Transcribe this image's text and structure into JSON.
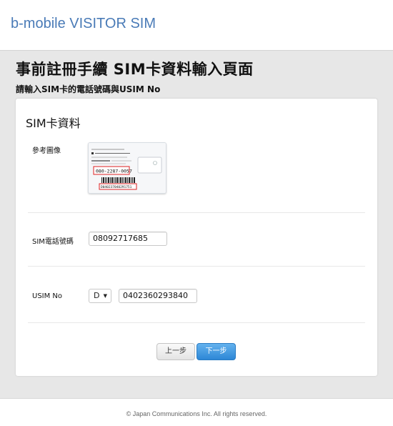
{
  "header": {
    "brand": "b-mobile VISITOR SIM"
  },
  "page": {
    "title": "事前註冊手續 SIM卡資料輸入頁面",
    "subtitle": "請輸入SIM卡的電話號碼與USIM No"
  },
  "form": {
    "section_title": "SIM卡資料",
    "reference_label": "參考圖像",
    "phone_label": "SIM電話號碼",
    "phone_value": "08092717685",
    "usim_label": "USIM No",
    "usim_prefix_value": "D",
    "usim_value": "0402360293840",
    "reference_card": {
      "line1": "ご不明な点がありましたら",
      "line2": "b-mobileサポート",
      "phone_number": "03-5767-9111",
      "sim_phone": "080-2287-0057",
      "barcode_number": "D040237040291751"
    }
  },
  "buttons": {
    "prev": "上一步",
    "next": "下一步"
  },
  "footer": {
    "copyright": "© Japan Communications Inc. All rights reserved."
  },
  "colors": {
    "brand": "#4a7bb7",
    "primary_button": "#3a92dd"
  }
}
